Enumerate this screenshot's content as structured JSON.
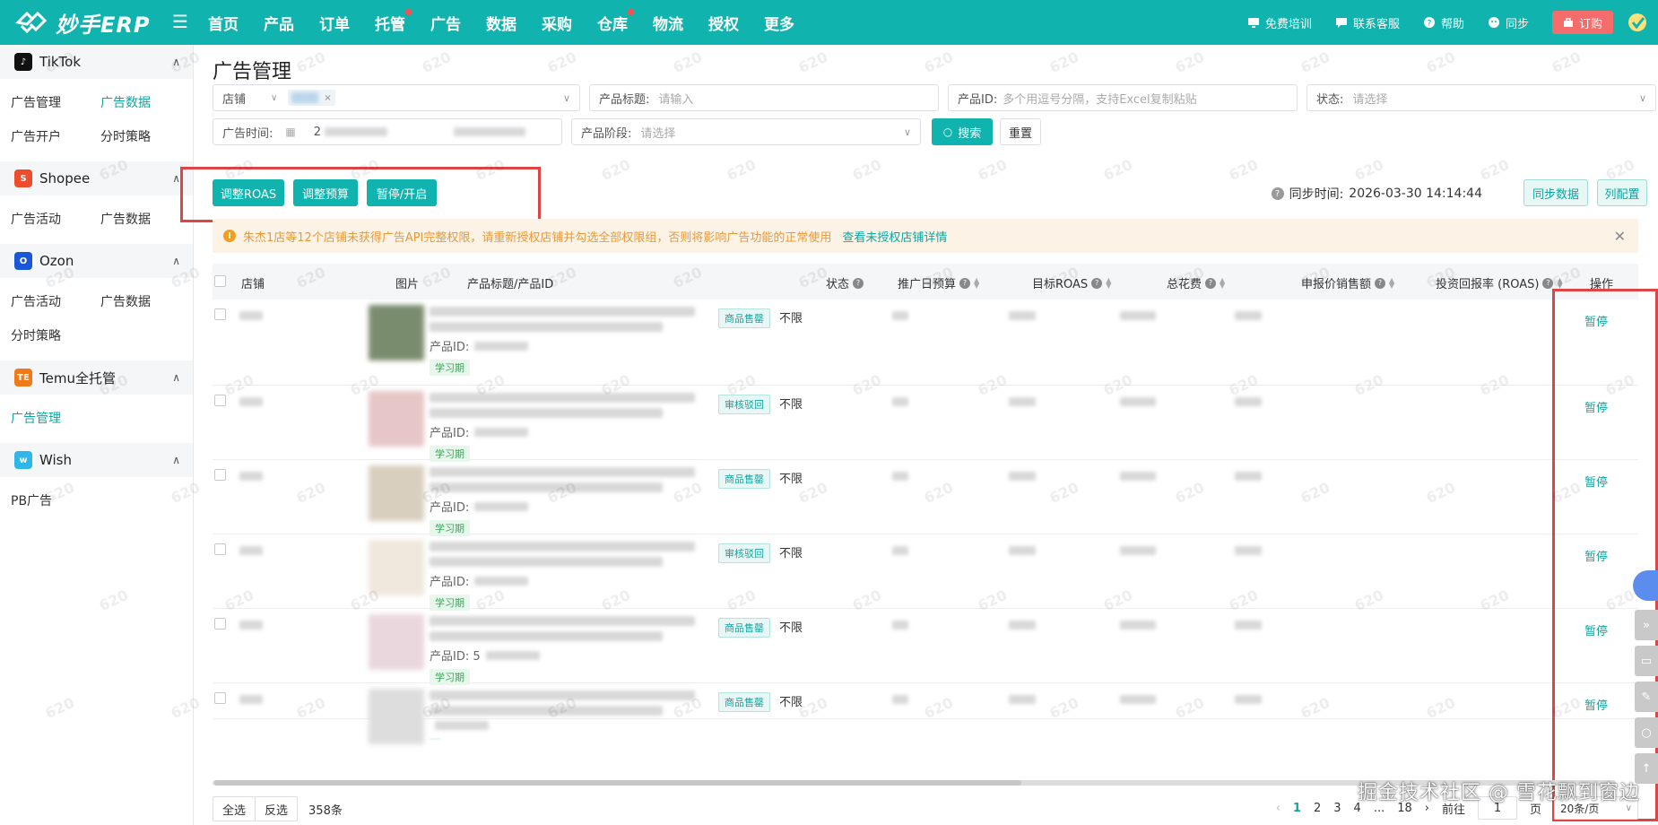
{
  "brand": {
    "name": "妙手ERP",
    "accent": "#10b3ad"
  },
  "nav": {
    "items": [
      {
        "label": "首页",
        "dot": false
      },
      {
        "label": "产品",
        "dot": false
      },
      {
        "label": "订单",
        "dot": false
      },
      {
        "label": "托管",
        "dot": true
      },
      {
        "label": "广告",
        "dot": false
      },
      {
        "label": "数据",
        "dot": false
      },
      {
        "label": "采购",
        "dot": false
      },
      {
        "label": "仓库",
        "dot": true
      },
      {
        "label": "物流",
        "dot": false
      },
      {
        "label": "授权",
        "dot": false
      },
      {
        "label": "更多",
        "dot": false
      }
    ],
    "right": {
      "training": "免费培训",
      "support": "联系客服",
      "help": "帮助",
      "sync": "同步",
      "order": "订购"
    }
  },
  "sidebar": {
    "groups": [
      {
        "name": "TikTok",
        "icon": "tiktok-icon",
        "color": "#111111",
        "items": [
          "广告管理",
          "广告数据",
          "广告开户",
          "分时策略"
        ],
        "active": "广告数据"
      },
      {
        "name": "Shopee",
        "icon": "shopee-icon",
        "color": "#ee4d2d",
        "items": [
          "广告活动",
          "广告数据"
        ],
        "active": ""
      },
      {
        "name": "Ozon",
        "icon": "ozon-icon",
        "color": "#1a57d8",
        "items": [
          "广告活动",
          "广告数据",
          "分时策略"
        ],
        "active": ""
      },
      {
        "name": "Temu全托管",
        "icon": "temu-icon",
        "color": "#f07a18",
        "items": [
          "广告管理"
        ],
        "active": "广告管理"
      },
      {
        "name": "Wish",
        "icon": "wish-icon",
        "color": "#2fb7ec",
        "items": [
          "PB广告"
        ],
        "active": ""
      }
    ]
  },
  "page": {
    "title": "广告管理"
  },
  "filters": {
    "store_label": "店铺",
    "title_label": "产品标题:",
    "title_placeholder": "请输入",
    "pid_label": "产品ID:",
    "pid_placeholder": "多个用逗号分隔，支持Excel复制粘贴",
    "status_label": "状态:",
    "status_placeholder": "请选择",
    "time_label": "广告时间:",
    "time_value": "2",
    "stage_label": "产品阶段:",
    "stage_placeholder": "请选择",
    "search": "搜索",
    "reset": "重置"
  },
  "actions": {
    "roas": "调整ROAS",
    "budget": "调整预算",
    "pause": "暂停/开启",
    "sync_prefix": "同步时间:",
    "sync_time": "2026-03-30 14:14:44",
    "sync_btn": "同步数据",
    "columns_btn": "列配置"
  },
  "warning": {
    "text": "朱杰1店等12个店铺未获得广告API完整权限，请重新授权店铺并勾选全部权限组，否则将影响广告功能的正常使用",
    "link": "查看未授权店铺详情"
  },
  "table": {
    "headers": {
      "store": "店铺",
      "image": "图片",
      "title": "产品标题/产品ID",
      "status": "状态",
      "budget": "推广日预算",
      "target_roas": "目标ROAS",
      "spend": "总花费",
      "sales": "申报价销售额",
      "roas": "投资回报率 (ROAS)",
      "op": "操作"
    },
    "rows": [
      {
        "status": "商品售罄",
        "budget": "不限",
        "pid_prefix": "产品ID:",
        "stage": "学习期",
        "op": "暂停",
        "thumb": "#7a8c6e"
      },
      {
        "status": "审核驳回",
        "budget": "不限",
        "pid_prefix": "产品ID:",
        "stage": "学习期",
        "op": "暂停",
        "thumb": "#e6c6c6"
      },
      {
        "status": "商品售罄",
        "budget": "不限",
        "pid_prefix": "产品ID:",
        "stage": "学习期",
        "op": "暂停",
        "thumb": "#d9cfbf"
      },
      {
        "status": "审核驳回",
        "budget": "不限",
        "pid_prefix": "产品ID:",
        "stage": "学习期",
        "op": "暂停",
        "thumb": "#efe8dc"
      },
      {
        "status": "商品售罄",
        "budget": "不限",
        "pid_prefix": "产品ID: 5",
        "stage": "学习期",
        "op": "暂停",
        "thumb": "#e9d7dd"
      },
      {
        "status": "商品售罄",
        "budget": "不限",
        "pid_prefix": "",
        "stage": "",
        "op": "暂停",
        "thumb": "#dddddd"
      }
    ]
  },
  "footer": {
    "select_all": "全选",
    "invert": "反选",
    "total": "358条",
    "pages": [
      "1",
      "2",
      "3",
      "4",
      "...",
      "18"
    ],
    "goto_label": "前往",
    "goto_value": "1",
    "page_unit": "页",
    "page_size": "20条/页"
  },
  "watermark": "620",
  "credit": "掘金技术社区 @ 雪花飘到窗边"
}
